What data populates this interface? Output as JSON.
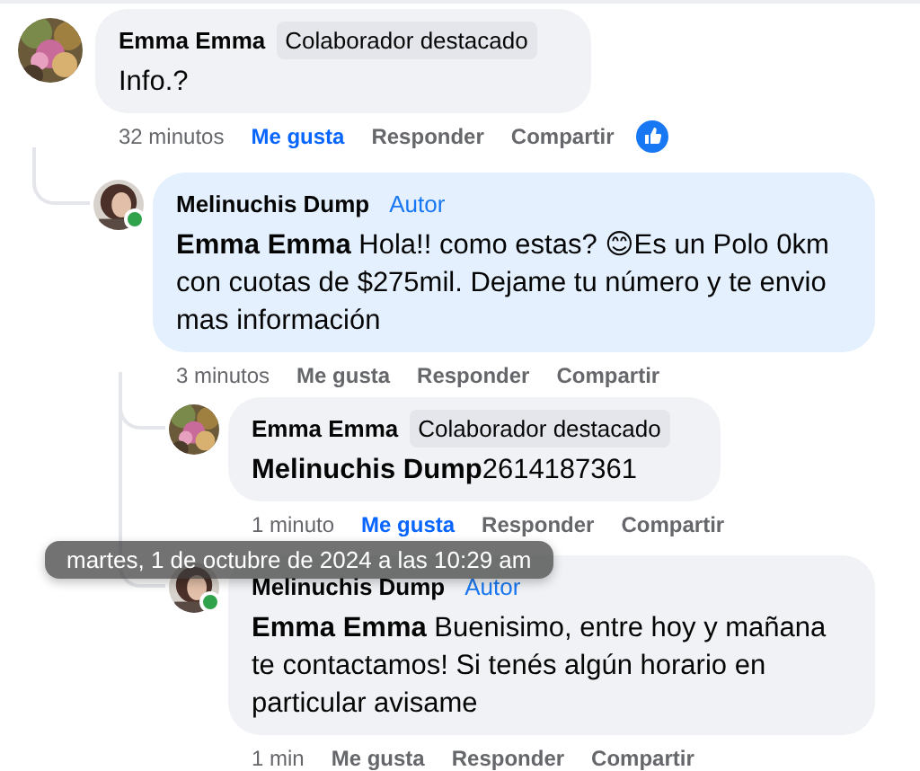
{
  "comments": [
    {
      "author": "Emma Emma",
      "badge": {
        "kind": "collaborator",
        "text": "Colaborador destacado"
      },
      "online": false,
      "highlighted": false,
      "text": "Info.?",
      "time": "32 minutos",
      "like": "Me gusta",
      "liked": true,
      "reply": "Responder",
      "share": "Compartir",
      "reaction": true,
      "children": [
        {
          "author": "Melinuchis Dump",
          "badge": {
            "kind": "author",
            "text": "Autor"
          },
          "online": true,
          "highlighted": true,
          "mention": "Emma Emma",
          "text": "Hola!! como estas? 😊Es un Polo 0km con cuotas de $275mil. Dejame tu número y te envio mas información",
          "time": "3 minutos",
          "like": "Me gusta",
          "liked": false,
          "reply": "Responder",
          "share": "Compartir",
          "reaction": false,
          "children": [
            {
              "author": "Emma Emma",
              "badge": {
                "kind": "collaborator",
                "text": "Colaborador destacado"
              },
              "online": false,
              "highlighted": false,
              "mention": "Melinuchis Dump",
              "text": "2614187361",
              "time": "1 minuto",
              "like": "Me gusta",
              "liked": true,
              "reply": "Responder",
              "share": "Compartir",
              "reaction": false
            },
            {
              "author": "Melinuchis Dump",
              "badge": {
                "kind": "author",
                "text": "Autor"
              },
              "online": true,
              "highlighted": false,
              "mention": "Emma Emma",
              "text": "Buenisimo, entre hoy y mañana te contactamos! Si tenés algún horario en particular avisame",
              "time": "1 min",
              "like": "Me gusta",
              "liked": false,
              "reply": "Responder",
              "share": "Compartir",
              "reaction": false
            }
          ]
        }
      ]
    }
  ],
  "tooltip": {
    "text": "martes, 1 de octubre de 2024 a las 10:29 am"
  }
}
